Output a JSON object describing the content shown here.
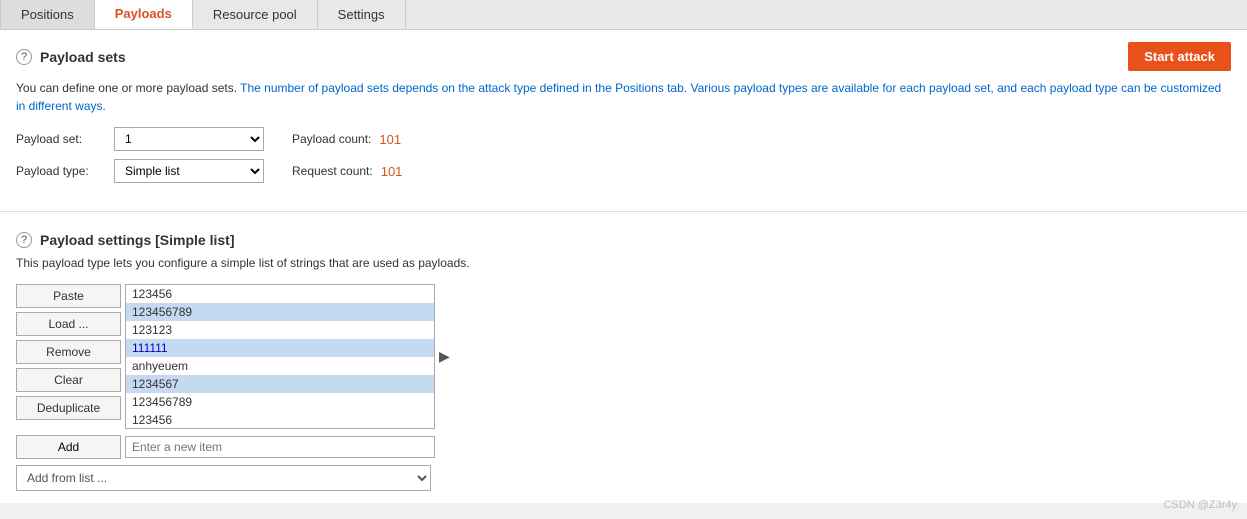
{
  "tabs": [
    {
      "id": "positions",
      "label": "Positions",
      "active": false
    },
    {
      "id": "payloads",
      "label": "Payloads",
      "active": true
    },
    {
      "id": "resource-pool",
      "label": "Resource pool",
      "active": false
    },
    {
      "id": "settings",
      "label": "Settings",
      "active": false
    }
  ],
  "payload_sets_section": {
    "title": "Payload sets",
    "start_attack_label": "Start attack",
    "description_part1": "You can define one or more payload sets. ",
    "description_highlight": "The number of payload sets depends on the attack type defined in the Positions tab. Various payload types are available for each payload set, and each payload type can be customized in different ways.",
    "payload_set_label": "Payload set:",
    "payload_set_value": "1",
    "payload_count_label": "Payload count:",
    "payload_count_value": "101",
    "payload_type_label": "Payload type:",
    "payload_type_value": "Simple list",
    "request_count_label": "Request count:",
    "request_count_value": "101"
  },
  "payload_settings_section": {
    "title": "Payload settings [Simple list]",
    "description": "This payload type lets you configure a simple list of strings that are used as payloads.",
    "buttons": {
      "paste": "Paste",
      "load": "Load ...",
      "remove": "Remove",
      "clear": "Clear",
      "deduplicate": "Deduplicate",
      "add": "Add",
      "add_from_list": "Add from list ..."
    },
    "list_items": [
      {
        "value": "123456",
        "selected": false,
        "color": "default"
      },
      {
        "value": "123456789",
        "selected": false,
        "color": "highlighted"
      },
      {
        "value": "123123",
        "selected": false,
        "color": "default"
      },
      {
        "value": "111111",
        "selected": true,
        "color": "blue"
      },
      {
        "value": "anhyeuem",
        "selected": false,
        "color": "default"
      },
      {
        "value": "1234567",
        "selected": false,
        "color": "highlighted"
      },
      {
        "value": "123456789",
        "selected": false,
        "color": "default"
      },
      {
        "value": "123456",
        "selected": false,
        "color": "partial"
      }
    ],
    "add_placeholder": "Enter a new item",
    "add_from_list_placeholder": "Add from list ..."
  },
  "watermark": "CSDN @Z3r4y"
}
